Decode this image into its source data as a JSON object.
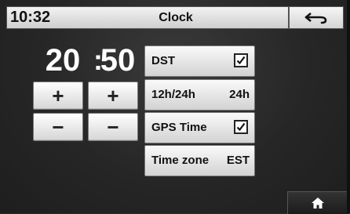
{
  "header": {
    "time": "10:32",
    "title": "Clock",
    "back_icon": "back-arrow-icon"
  },
  "clock": {
    "hours": "20",
    "separator": ":",
    "minutes": "50"
  },
  "adjust": {
    "plus": "+",
    "minus": "−"
  },
  "settings": {
    "dst": {
      "label": "DST",
      "checked": true
    },
    "format": {
      "label": "12h/24h",
      "value": "24h"
    },
    "gps_time": {
      "label": "GPS Time",
      "checked": true
    },
    "time_zone": {
      "label": "Time zone",
      "value": "EST"
    }
  },
  "footer": {
    "home_icon": "home-icon"
  }
}
